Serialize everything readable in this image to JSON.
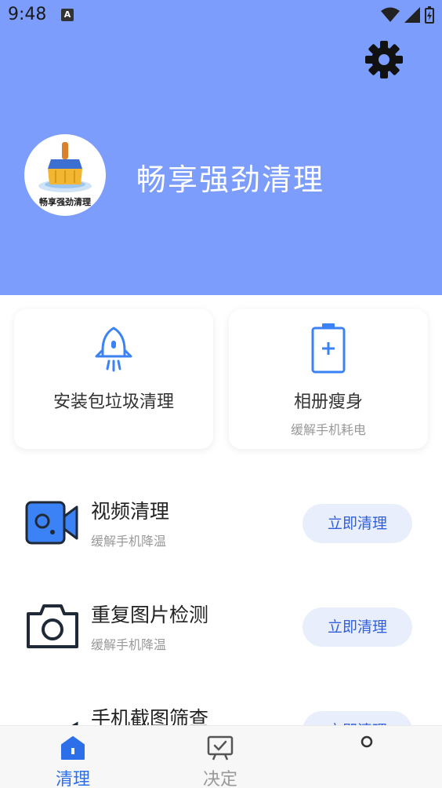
{
  "status_bar": {
    "time": "9:48",
    "notification_letter": "A"
  },
  "header": {
    "app_title": "畅享强劲清理",
    "logo_text": "畅享强劲清理",
    "background_color": "#7c9dfb"
  },
  "cards": [
    {
      "title": "安装包垃圾清理",
      "subtitle": "",
      "icon": "rocket-icon"
    },
    {
      "title": "相册瘦身",
      "subtitle": "缓解手机耗电",
      "icon": "battery-icon"
    }
  ],
  "rows": [
    {
      "title": "视频清理",
      "subtitle": "缓解手机降温",
      "button": "立即清理",
      "icon": "video-camera-icon"
    },
    {
      "title": "重复图片检测",
      "subtitle": "缓解手机降温",
      "button": "立即清理",
      "icon": "camera-icon"
    },
    {
      "title": "手机截图筛查",
      "subtitle": "",
      "button": "立即清理",
      "icon": "screenshot-icon"
    }
  ],
  "bottom_nav": [
    {
      "label": "清理",
      "active": true,
      "icon": "home-icon"
    },
    {
      "label": "决定",
      "active": false,
      "icon": "check-board-icon"
    },
    {
      "label": "",
      "active": false,
      "icon": "circle-icon"
    }
  ],
  "colors": {
    "accent": "#2d6fe8",
    "button_bg": "#e9eefc",
    "icon_blue": "#3b82f6"
  }
}
